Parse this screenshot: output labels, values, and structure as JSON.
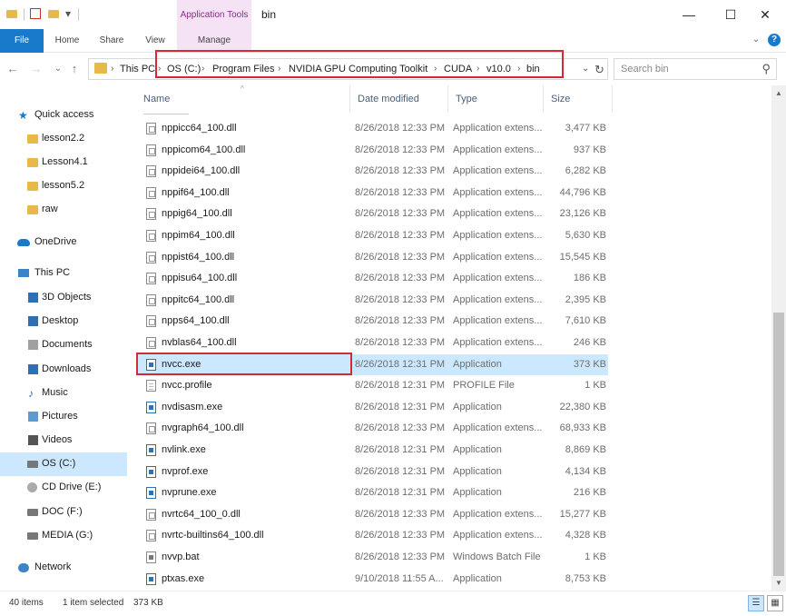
{
  "window": {
    "title": "bin",
    "context_tab_group": "Application Tools",
    "minimize_glyph": "—",
    "maximize_glyph": "☐",
    "close_glyph": "✕"
  },
  "quick_access_toolbar": {
    "icons": [
      "folder-icon",
      "properties-checkbox-icon",
      "new-folder-icon",
      "customize-dropdown-icon"
    ],
    "dropdown_glyph": "▾"
  },
  "ribbon": {
    "tabs": [
      "File",
      "Home",
      "Share",
      "View",
      "Manage"
    ],
    "active_tab": "File",
    "collapse_glyph": "⌄",
    "help_glyph": "?"
  },
  "navigation": {
    "back_glyph": "←",
    "forward_glyph": "→",
    "recent_glyph": "⌄",
    "up_glyph": "↑"
  },
  "address": {
    "breadcrumbs": [
      "This PC",
      "OS (C:)",
      "Program Files",
      "NVIDIA GPU Computing Toolkit",
      "CUDA",
      "v10.0",
      "bin"
    ],
    "separator": "›",
    "dropdown_glyph": "⌄",
    "refresh_glyph": "↻"
  },
  "search": {
    "placeholder": "Search bin",
    "icon_glyph": "⚲"
  },
  "sidebar": {
    "items": [
      {
        "label": "Quick access",
        "icon": "star-icon"
      },
      {
        "label": "lesson2.2",
        "icon": "folder-icon"
      },
      {
        "label": "Lesson4.1",
        "icon": "folder-icon"
      },
      {
        "label": "lesson5.2",
        "icon": "folder-icon"
      },
      {
        "label": "raw",
        "icon": "folder-icon"
      },
      {
        "label": "OneDrive",
        "icon": "cloud-icon"
      },
      {
        "label": "This PC",
        "icon": "computer-icon"
      },
      {
        "label": "3D Objects",
        "icon": "cube-icon"
      },
      {
        "label": "Desktop",
        "icon": "desktop-icon"
      },
      {
        "label": "Documents",
        "icon": "documents-icon"
      },
      {
        "label": "Downloads",
        "icon": "download-icon"
      },
      {
        "label": "Music",
        "icon": "music-icon"
      },
      {
        "label": "Pictures",
        "icon": "pictures-icon"
      },
      {
        "label": "Videos",
        "icon": "videos-icon"
      },
      {
        "label": "OS (C:)",
        "icon": "drive-icon"
      },
      {
        "label": "CD Drive (E:)",
        "icon": "cd-drive-icon"
      },
      {
        "label": "DOC (F:)",
        "icon": "drive-icon"
      },
      {
        "label": "MEDIA (G:)",
        "icon": "drive-icon"
      },
      {
        "label": "Network",
        "icon": "network-icon"
      }
    ],
    "selected": "OS (C:)",
    "star_glyph": "★",
    "music_glyph": "♪"
  },
  "file_list": {
    "columns": [
      "Name",
      "Date modified",
      "Type",
      "Size"
    ],
    "sort_glyph": "^",
    "rows": [
      {
        "name": "nppicc64_100.dll",
        "date": "8/26/2018 12:33 PM",
        "type": "Application extens...",
        "size": "3,477 KB",
        "icon": "dll-file-icon"
      },
      {
        "name": "nppicom64_100.dll",
        "date": "8/26/2018 12:33 PM",
        "type": "Application extens...",
        "size": "937 KB",
        "icon": "dll-file-icon"
      },
      {
        "name": "nppidei64_100.dll",
        "date": "8/26/2018 12:33 PM",
        "type": "Application extens...",
        "size": "6,282 KB",
        "icon": "dll-file-icon"
      },
      {
        "name": "nppif64_100.dll",
        "date": "8/26/2018 12:33 PM",
        "type": "Application extens...",
        "size": "44,796 KB",
        "icon": "dll-file-icon"
      },
      {
        "name": "nppig64_100.dll",
        "date": "8/26/2018 12:33 PM",
        "type": "Application extens...",
        "size": "23,126 KB",
        "icon": "dll-file-icon"
      },
      {
        "name": "nppim64_100.dll",
        "date": "8/26/2018 12:33 PM",
        "type": "Application extens...",
        "size": "5,630 KB",
        "icon": "dll-file-icon"
      },
      {
        "name": "nppist64_100.dll",
        "date": "8/26/2018 12:33 PM",
        "type": "Application extens...",
        "size": "15,545 KB",
        "icon": "dll-file-icon"
      },
      {
        "name": "nppisu64_100.dll",
        "date": "8/26/2018 12:33 PM",
        "type": "Application extens...",
        "size": "186 KB",
        "icon": "dll-file-icon"
      },
      {
        "name": "nppitc64_100.dll",
        "date": "8/26/2018 12:33 PM",
        "type": "Application extens...",
        "size": "2,395 KB",
        "icon": "dll-file-icon"
      },
      {
        "name": "npps64_100.dll",
        "date": "8/26/2018 12:33 PM",
        "type": "Application extens...",
        "size": "7,610 KB",
        "icon": "dll-file-icon"
      },
      {
        "name": "nvblas64_100.dll",
        "date": "8/26/2018 12:33 PM",
        "type": "Application extens...",
        "size": "246 KB",
        "icon": "dll-file-icon"
      },
      {
        "name": "nvcc.exe",
        "date": "8/26/2018 12:31 PM",
        "type": "Application",
        "size": "373 KB",
        "icon": "exe-file-icon"
      },
      {
        "name": "nvcc.profile",
        "date": "8/26/2018 12:31 PM",
        "type": "PROFILE File",
        "size": "1 KB",
        "icon": "plain-file-icon"
      },
      {
        "name": "nvdisasm.exe",
        "date": "8/26/2018 12:31 PM",
        "type": "Application",
        "size": "22,380 KB",
        "icon": "exe-file-icon"
      },
      {
        "name": "nvgraph64_100.dll",
        "date": "8/26/2018 12:33 PM",
        "type": "Application extens...",
        "size": "68,933 KB",
        "icon": "dll-file-icon"
      },
      {
        "name": "nvlink.exe",
        "date": "8/26/2018 12:31 PM",
        "type": "Application",
        "size": "8,869 KB",
        "icon": "exe-file-icon"
      },
      {
        "name": "nvprof.exe",
        "date": "8/26/2018 12:31 PM",
        "type": "Application",
        "size": "4,134 KB",
        "icon": "exe-file-icon"
      },
      {
        "name": "nvprune.exe",
        "date": "8/26/2018 12:31 PM",
        "type": "Application",
        "size": "216 KB",
        "icon": "exe-file-icon"
      },
      {
        "name": "nvrtc64_100_0.dll",
        "date": "8/26/2018 12:33 PM",
        "type": "Application extens...",
        "size": "15,277 KB",
        "icon": "dll-file-icon"
      },
      {
        "name": "nvrtc-builtins64_100.dll",
        "date": "8/26/2018 12:33 PM",
        "type": "Application extens...",
        "size": "4,328 KB",
        "icon": "dll-file-icon"
      },
      {
        "name": "nvvp.bat",
        "date": "8/26/2018 12:33 PM",
        "type": "Windows Batch File",
        "size": "1 KB",
        "icon": "batch-file-icon"
      },
      {
        "name": "ptxas.exe",
        "date": "9/10/2018 11:55 A...",
        "type": "Application",
        "size": "8,753 KB",
        "icon": "exe-file-icon"
      }
    ],
    "selected": "nvcc.exe"
  },
  "scrollbar": {
    "up_glyph": "▲",
    "down_glyph": "▼"
  },
  "status": {
    "item_count": "40 items",
    "selection": "1 item selected",
    "selection_size": "373 KB",
    "details_view_glyph": "☰",
    "tiles_view_glyph": "▦"
  },
  "colors": {
    "accent": "#1979ca",
    "selection": "#cce8ff",
    "context_tab": "#f5e3f5",
    "annotation_red": "#d42a36"
  }
}
